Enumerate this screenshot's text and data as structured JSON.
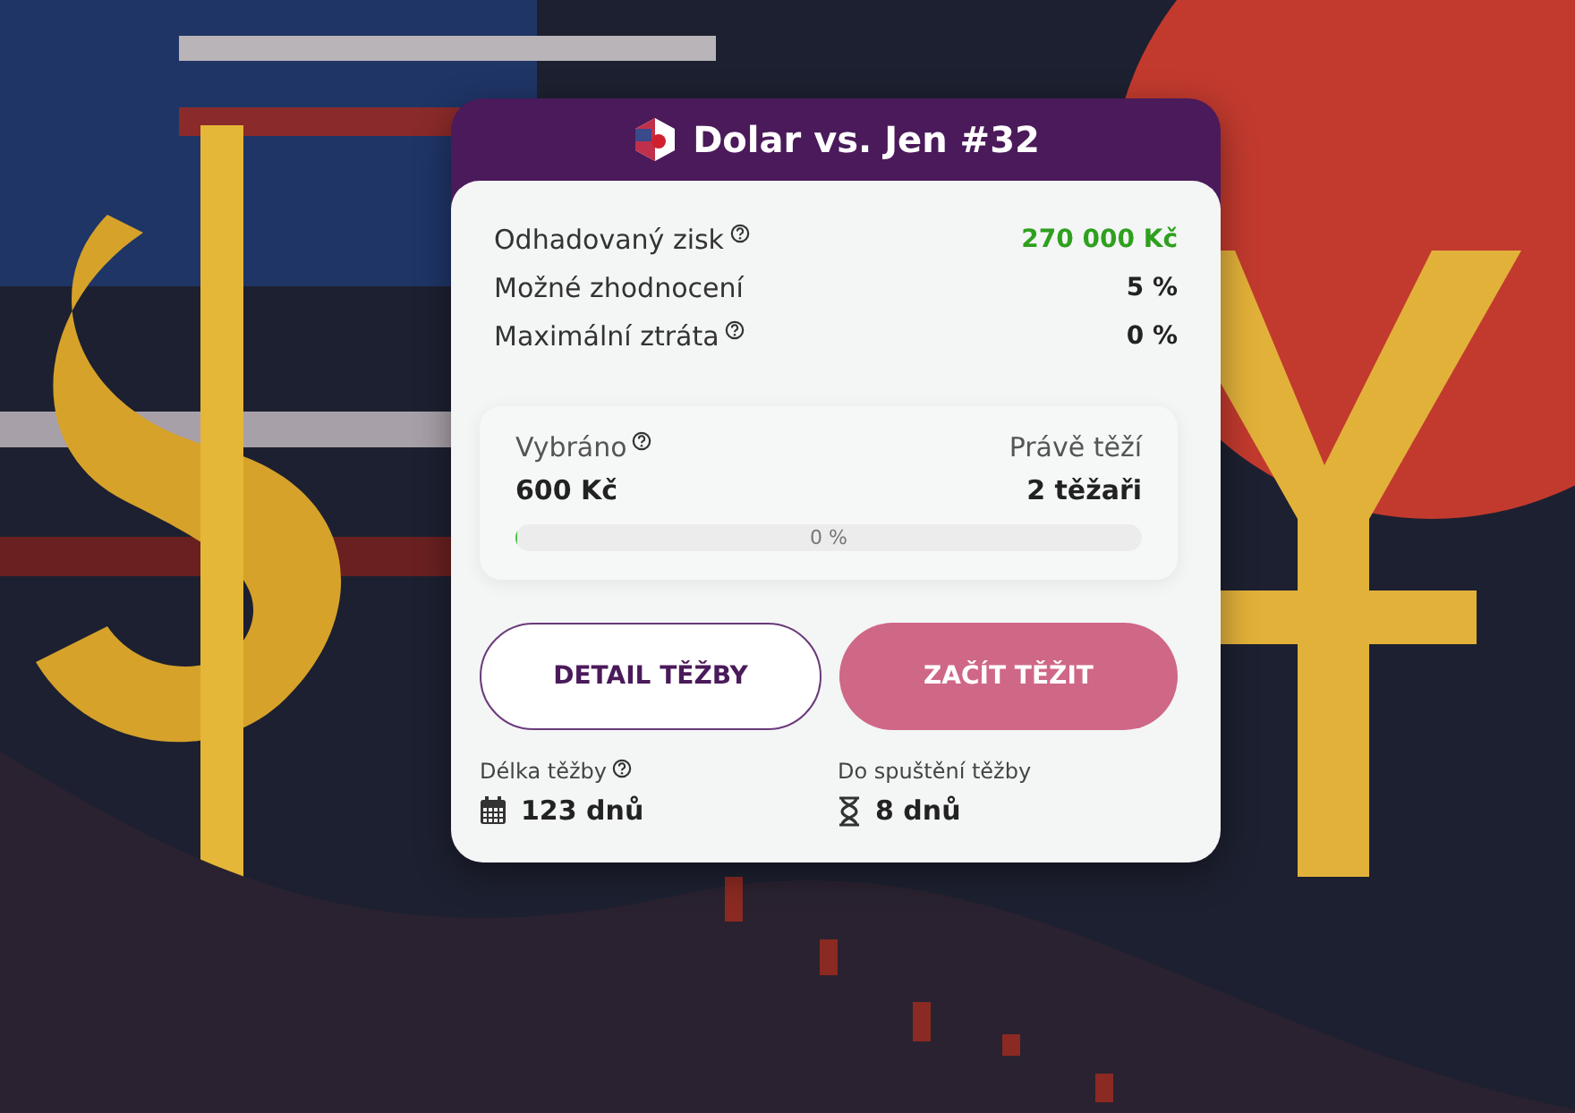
{
  "card": {
    "title": "Dolar vs. Jen #32",
    "stats": [
      {
        "label": "Odhadovaný zisk",
        "help": true,
        "value": "270 000 Kč",
        "highlight": true
      },
      {
        "label": "Možné zhodnocení",
        "help": false,
        "value": "5 %",
        "highlight": false
      },
      {
        "label": "Maximální ztráta",
        "help": true,
        "value": "0 %",
        "highlight": false
      }
    ],
    "funding": {
      "raised_label": "Vybráno",
      "raised_value": "600 Kč",
      "miners_label": "Právě těží",
      "miners_value": "2 těžaři",
      "progress_text": "0 %",
      "level": 0
    },
    "buttons": [
      {
        "label": "DETAIL TĚŽBY",
        "kind": "outline"
      },
      {
        "label": "ZAČÍT TĚŽIT",
        "kind": "filled"
      }
    ],
    "facts": [
      {
        "label": "Délka těžby",
        "help": true,
        "kind": "calendar",
        "value": "123 dnů"
      },
      {
        "label": "Do spuštění těžby",
        "help": false,
        "kind": "hourglass",
        "value": "8 dnů"
      }
    ]
  }
}
